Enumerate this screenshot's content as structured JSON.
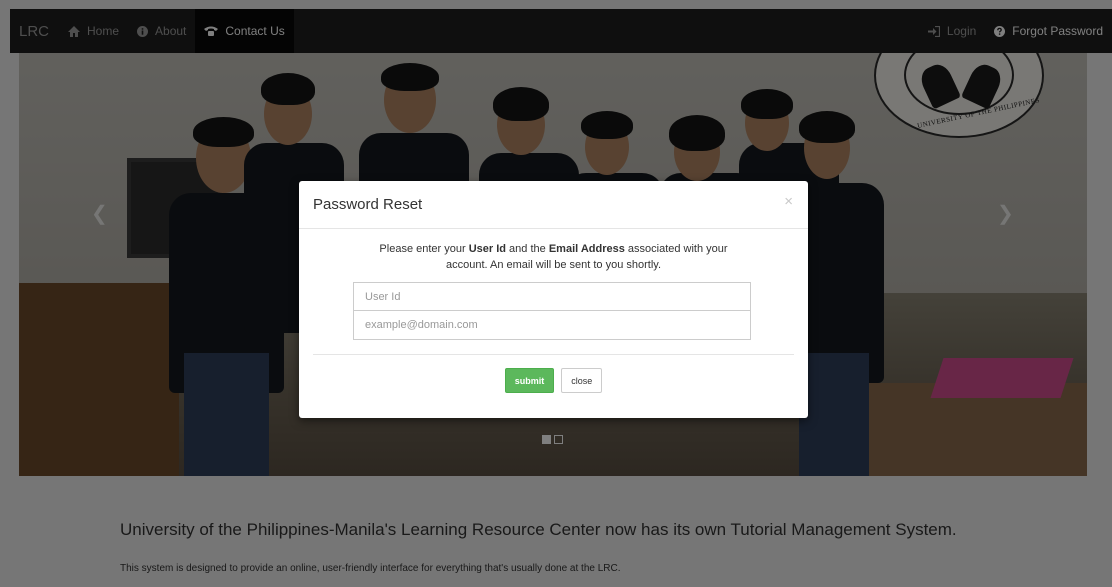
{
  "navbar": {
    "brand": "LRC",
    "items": [
      {
        "label": "Home",
        "icon": "home-icon"
      },
      {
        "label": "About",
        "icon": "info-icon"
      },
      {
        "label": "Contact Us",
        "icon": "phone-icon"
      }
    ],
    "right_items": [
      {
        "label": "Login",
        "icon": "login-icon"
      },
      {
        "label": "Forgot Password",
        "icon": "question-icon"
      }
    ]
  },
  "carousel": {
    "seal_text": "UNIVERSITY OF THE PHILIPPINES"
  },
  "modal": {
    "title": "Password Reset",
    "close_symbol": "×",
    "message_parts": [
      "Please enter your ",
      "User Id",
      " and the ",
      "Email Address",
      " associated with your account. An email will be sent to you shortly."
    ],
    "user_id_placeholder": "User Id",
    "email_placeholder": "example@domain.com",
    "submit_label": "submit",
    "close_label": "close"
  },
  "content": {
    "headline": "University of the Philippines-Manila's Learning Resource Center now has its own Tutorial Management System.",
    "subline": "This system is designed to provide an online, user-friendly interface for everything that's usually done at the LRC."
  },
  "colors": {
    "navbar": "#1f1f1f",
    "submit": "#5cb85c"
  }
}
